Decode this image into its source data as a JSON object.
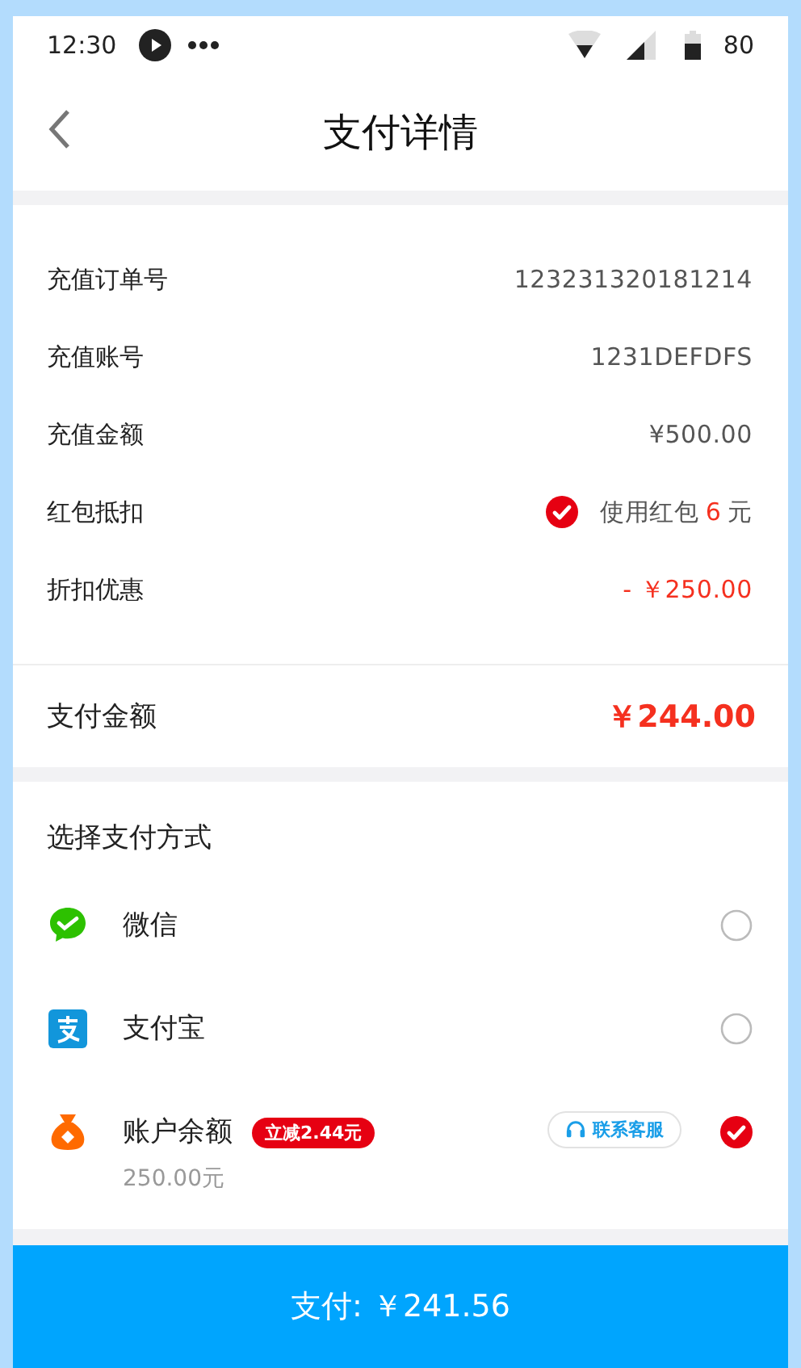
{
  "status_bar": {
    "time": "12:30",
    "battery": "80"
  },
  "header": {
    "title": "支付详情"
  },
  "details": [
    {
      "label": "充值订单号",
      "kind": "plain",
      "value": "123231320181214"
    },
    {
      "label": "充值账号",
      "kind": "plain",
      "value": "1231DEFDFS"
    },
    {
      "label": "充值金额",
      "kind": "plain",
      "value": "¥500.00"
    },
    {
      "label": "红包抵扣",
      "kind": "coupon",
      "checked": true,
      "prefix": "使用红包",
      "amount": "6",
      "suffix": "元"
    },
    {
      "label": "折扣优惠",
      "kind": "discount",
      "value": "- ￥250.00"
    }
  ],
  "total": {
    "label": "支付金额",
    "value": "￥244.00"
  },
  "methods_title": "选择支付方式",
  "methods": [
    {
      "name": "微信",
      "kind": "wechat",
      "selected": false
    },
    {
      "name": "支付宝",
      "kind": "alipay",
      "selected": false
    },
    {
      "name": "账户余额",
      "kind": "balance",
      "selected": true,
      "badge": "立减2.44元",
      "balance": "250.00元",
      "support": "联系客服"
    }
  ],
  "pay_button": "支付: ￥241.56"
}
